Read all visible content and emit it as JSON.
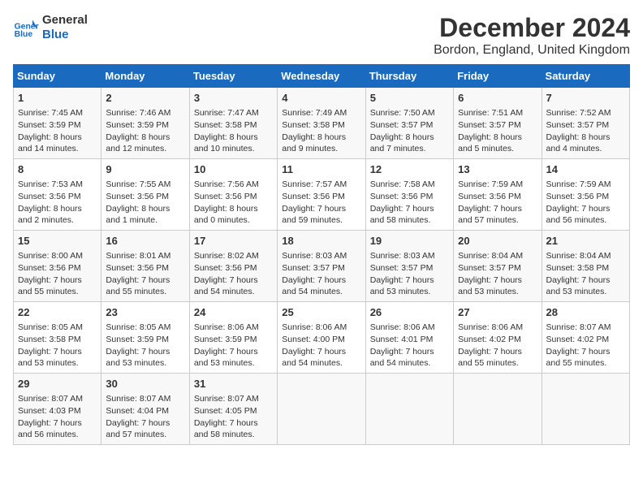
{
  "header": {
    "logo_line1": "General",
    "logo_line2": "Blue",
    "month": "December 2024",
    "location": "Bordon, England, United Kingdom"
  },
  "days_of_week": [
    "Sunday",
    "Monday",
    "Tuesday",
    "Wednesday",
    "Thursday",
    "Friday",
    "Saturday"
  ],
  "weeks": [
    [
      {
        "day": "1",
        "sunrise": "7:45 AM",
        "sunset": "3:59 PM",
        "daylight": "8 hours and 14 minutes."
      },
      {
        "day": "2",
        "sunrise": "7:46 AM",
        "sunset": "3:59 PM",
        "daylight": "8 hours and 12 minutes."
      },
      {
        "day": "3",
        "sunrise": "7:47 AM",
        "sunset": "3:58 PM",
        "daylight": "8 hours and 10 minutes."
      },
      {
        "day": "4",
        "sunrise": "7:49 AM",
        "sunset": "3:58 PM",
        "daylight": "8 hours and 9 minutes."
      },
      {
        "day": "5",
        "sunrise": "7:50 AM",
        "sunset": "3:57 PM",
        "daylight": "8 hours and 7 minutes."
      },
      {
        "day": "6",
        "sunrise": "7:51 AM",
        "sunset": "3:57 PM",
        "daylight": "8 hours and 5 minutes."
      },
      {
        "day": "7",
        "sunrise": "7:52 AM",
        "sunset": "3:57 PM",
        "daylight": "8 hours and 4 minutes."
      }
    ],
    [
      {
        "day": "8",
        "sunrise": "7:53 AM",
        "sunset": "3:56 PM",
        "daylight": "8 hours and 2 minutes."
      },
      {
        "day": "9",
        "sunrise": "7:55 AM",
        "sunset": "3:56 PM",
        "daylight": "8 hours and 1 minute."
      },
      {
        "day": "10",
        "sunrise": "7:56 AM",
        "sunset": "3:56 PM",
        "daylight": "8 hours and 0 minutes."
      },
      {
        "day": "11",
        "sunrise": "7:57 AM",
        "sunset": "3:56 PM",
        "daylight": "7 hours and 59 minutes."
      },
      {
        "day": "12",
        "sunrise": "7:58 AM",
        "sunset": "3:56 PM",
        "daylight": "7 hours and 58 minutes."
      },
      {
        "day": "13",
        "sunrise": "7:59 AM",
        "sunset": "3:56 PM",
        "daylight": "7 hours and 57 minutes."
      },
      {
        "day": "14",
        "sunrise": "7:59 AM",
        "sunset": "3:56 PM",
        "daylight": "7 hours and 56 minutes."
      }
    ],
    [
      {
        "day": "15",
        "sunrise": "8:00 AM",
        "sunset": "3:56 PM",
        "daylight": "7 hours and 55 minutes."
      },
      {
        "day": "16",
        "sunrise": "8:01 AM",
        "sunset": "3:56 PM",
        "daylight": "7 hours and 55 minutes."
      },
      {
        "day": "17",
        "sunrise": "8:02 AM",
        "sunset": "3:56 PM",
        "daylight": "7 hours and 54 minutes."
      },
      {
        "day": "18",
        "sunrise": "8:03 AM",
        "sunset": "3:57 PM",
        "daylight": "7 hours and 54 minutes."
      },
      {
        "day": "19",
        "sunrise": "8:03 AM",
        "sunset": "3:57 PM",
        "daylight": "7 hours and 53 minutes."
      },
      {
        "day": "20",
        "sunrise": "8:04 AM",
        "sunset": "3:57 PM",
        "daylight": "7 hours and 53 minutes."
      },
      {
        "day": "21",
        "sunrise": "8:04 AM",
        "sunset": "3:58 PM",
        "daylight": "7 hours and 53 minutes."
      }
    ],
    [
      {
        "day": "22",
        "sunrise": "8:05 AM",
        "sunset": "3:58 PM",
        "daylight": "7 hours and 53 minutes."
      },
      {
        "day": "23",
        "sunrise": "8:05 AM",
        "sunset": "3:59 PM",
        "daylight": "7 hours and 53 minutes."
      },
      {
        "day": "24",
        "sunrise": "8:06 AM",
        "sunset": "3:59 PM",
        "daylight": "7 hours and 53 minutes."
      },
      {
        "day": "25",
        "sunrise": "8:06 AM",
        "sunset": "4:00 PM",
        "daylight": "7 hours and 54 minutes."
      },
      {
        "day": "26",
        "sunrise": "8:06 AM",
        "sunset": "4:01 PM",
        "daylight": "7 hours and 54 minutes."
      },
      {
        "day": "27",
        "sunrise": "8:06 AM",
        "sunset": "4:02 PM",
        "daylight": "7 hours and 55 minutes."
      },
      {
        "day": "28",
        "sunrise": "8:07 AM",
        "sunset": "4:02 PM",
        "daylight": "7 hours and 55 minutes."
      }
    ],
    [
      {
        "day": "29",
        "sunrise": "8:07 AM",
        "sunset": "4:03 PM",
        "daylight": "7 hours and 56 minutes."
      },
      {
        "day": "30",
        "sunrise": "8:07 AM",
        "sunset": "4:04 PM",
        "daylight": "7 hours and 57 minutes."
      },
      {
        "day": "31",
        "sunrise": "8:07 AM",
        "sunset": "4:05 PM",
        "daylight": "7 hours and 58 minutes."
      },
      null,
      null,
      null,
      null
    ]
  ]
}
